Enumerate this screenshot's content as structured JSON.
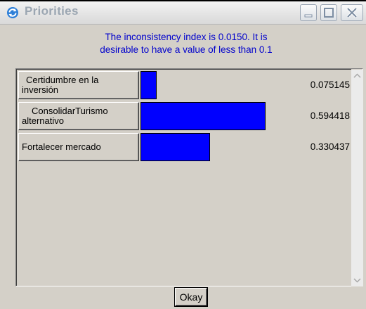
{
  "window": {
    "title": "Priorities",
    "icon": "refresh-arrows-icon",
    "controls": [
      "minimize-icon",
      "maximize-icon",
      "close-icon"
    ]
  },
  "message": {
    "line1": "The inconsistency index is 0.0150.  It is",
    "line2": "desirable to have a value of less than 0.1",
    "color": "#0000cc"
  },
  "priorities": [
    {
      "label_line1": "Certidumbre en la",
      "label_line2": "inversión",
      "value_text": "0.075145",
      "value": 0.075145
    },
    {
      "label_line1": "ConsolidarTurismo",
      "label_line2": "alternativo",
      "value_text": "0.594418",
      "value": 0.594418
    },
    {
      "label_line1": "Fortalecer mercado",
      "label_line2": "",
      "value_text": "0.330437",
      "value": 0.330437
    }
  ],
  "bar_color": "#0000ff",
  "footer": {
    "okay_label": "Okay"
  }
}
